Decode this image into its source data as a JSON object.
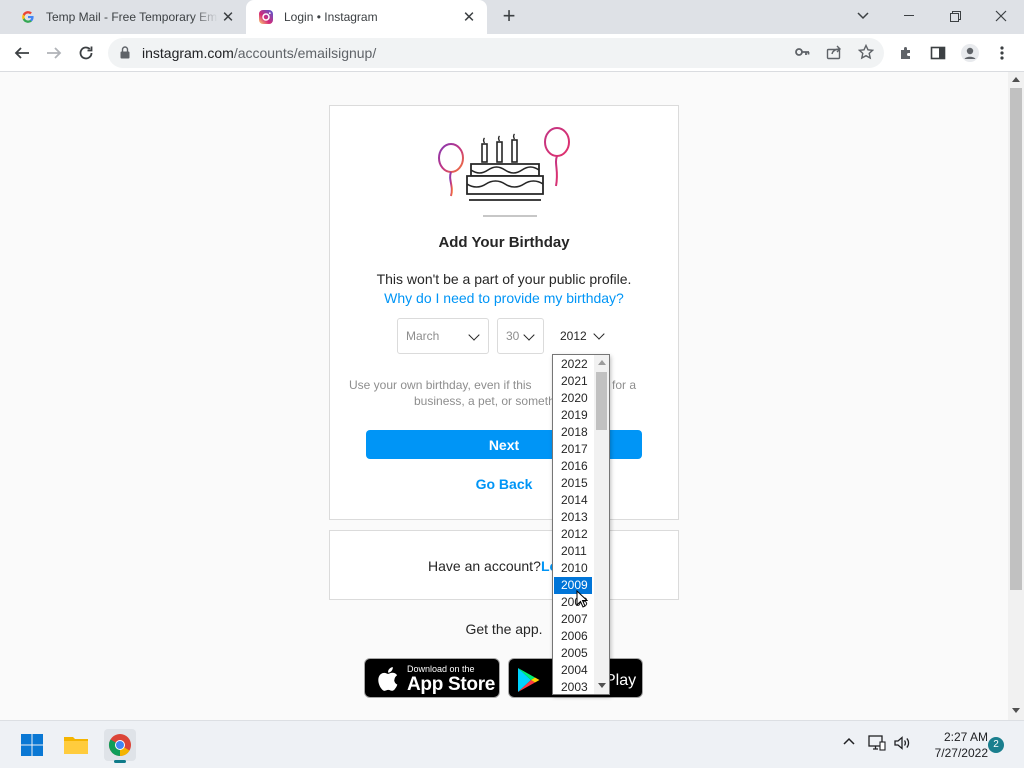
{
  "browser": {
    "tabs": [
      {
        "title": "Temp Mail - Free Temporary Email",
        "favicon": "google-icon",
        "active": false
      },
      {
        "title": "Login • Instagram",
        "favicon": "instagram-icon",
        "active": true
      }
    ],
    "url_host": "instagram.com",
    "url_path": "/accounts/emailsignup/"
  },
  "page": {
    "heading": "Add Your Birthday",
    "subtext": "This won't be a part of your public profile.",
    "why_link": "Why do I need to provide my birthday?",
    "month": "March",
    "day": "30",
    "year": "2012",
    "hint_line1": "Use your own birthday, even if this",
    "hint_line1_tail": "for a",
    "hint_line2": "business, a pet, or someth",
    "next_label": "Next",
    "goback_label": "Go Back",
    "have_account": "Have an account?",
    "login_link": "Lo",
    "get_app": "Get the app.",
    "appstore_small": "Download on the",
    "appstore_big": "App Store",
    "gplay_tail": "Play"
  },
  "year_dropdown": {
    "options": [
      "2022",
      "2021",
      "2020",
      "2019",
      "2018",
      "2017",
      "2016",
      "2015",
      "2014",
      "2013",
      "2012",
      "2011",
      "2010",
      "2009",
      "2008",
      "2007",
      "2006",
      "2005",
      "2004",
      "2003"
    ],
    "highlighted": "2009",
    "highlight_color": "#0075d8"
  },
  "taskbar": {
    "time": "2:27 AM",
    "date": "7/27/2022",
    "notification_count": "2"
  },
  "colors": {
    "accent": "#0095f6",
    "link": "#0095f6",
    "border": "#dbdbdb"
  }
}
